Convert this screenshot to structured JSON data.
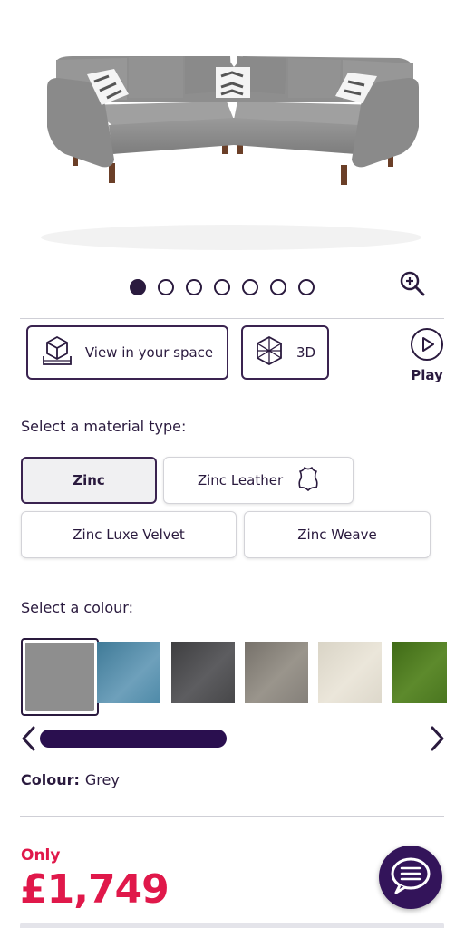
{
  "product": {
    "image_alt_icon": "corner-sofa-image",
    "gallery_pages": 7,
    "gallery_current": 1
  },
  "actions": {
    "view_in_space_label": "View in your space",
    "three_d_label": "3D",
    "play_label": "Play"
  },
  "material": {
    "title": "Select a material type:",
    "options": [
      {
        "label": "Zinc",
        "selected": true
      },
      {
        "label": "Zinc Leather",
        "selected": false,
        "icon": "leather-hide-icon"
      },
      {
        "label": "Zinc Luxe Velvet",
        "selected": false
      },
      {
        "label": "Zinc Weave",
        "selected": false
      }
    ]
  },
  "colour": {
    "title": "Select a colour:",
    "swatches": [
      {
        "color": "#8e8e8e",
        "selected": true
      },
      {
        "color": "#4e8aa8"
      },
      {
        "color": "#4f4f51"
      },
      {
        "color": "#8a857d"
      },
      {
        "color": "#e2ddd0"
      },
      {
        "color": "#4e7a22"
      }
    ],
    "selected_key": "Colour:",
    "selected_value": "Grey"
  },
  "price": {
    "prefix": "Only",
    "value": "£1,749",
    "color": "#e0184a"
  },
  "theme": {
    "primary": "#2a1a3e",
    "chat_bg": "#33145a"
  }
}
